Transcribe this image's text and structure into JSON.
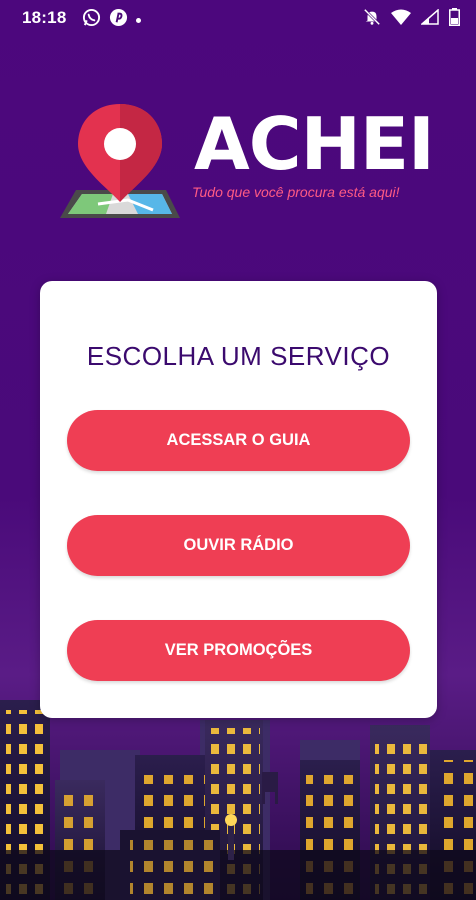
{
  "status_bar": {
    "time": "18:18",
    "left_icons": [
      "whatsapp-icon",
      "pinterest-icon",
      "notification-dot"
    ],
    "right_icons": [
      "muted-bell-icon",
      "wifi-icon",
      "signal-icon",
      "battery-icon"
    ]
  },
  "logo": {
    "brand": "ACHEI",
    "tagline": "Tudo que você procura está aqui!",
    "icon": "map-pin-icon"
  },
  "card": {
    "title": "ESCOLHA UM SERVIÇO",
    "buttons": [
      {
        "label": "ACESSAR O GUIA"
      },
      {
        "label": "OUVIR RÁDIO"
      },
      {
        "label": "VER PROMOÇÕES"
      }
    ]
  },
  "colors": {
    "background": "#4a0b78",
    "button": "#ef3e54",
    "title": "#3b0a6e",
    "tagline": "#ff5a84"
  }
}
